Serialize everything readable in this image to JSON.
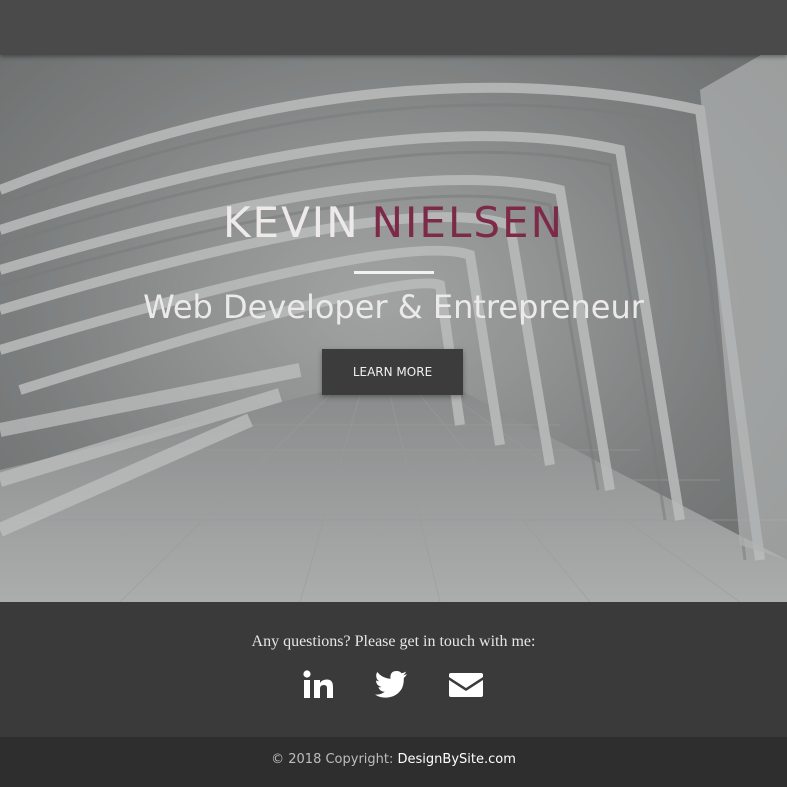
{
  "hero": {
    "first_name": "KEVIN",
    "last_name": "NIELSEN",
    "subtitle": "Web Developer & Entrepreneur",
    "button_label": "LEARN MORE",
    "accent_color": "#7d2a48",
    "background_image": "white-arched-corridor"
  },
  "contact": {
    "prompt": "Any questions? Please get in touch with me:",
    "socials": [
      {
        "name": "linkedin",
        "icon": "linkedin-icon"
      },
      {
        "name": "twitter",
        "icon": "twitter-icon"
      },
      {
        "name": "email",
        "icon": "envelope-icon"
      }
    ]
  },
  "footer": {
    "copyright": "© 2018 Copyright: ",
    "link_text": "DesignBySite.com"
  }
}
